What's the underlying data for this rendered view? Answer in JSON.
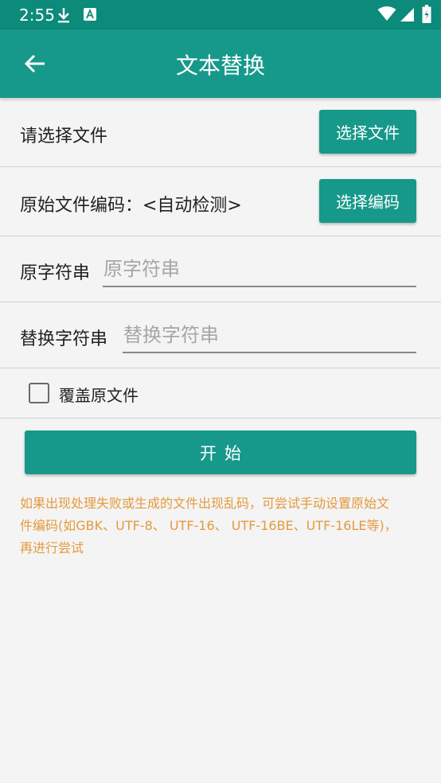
{
  "status_bar": {
    "time": "2:55",
    "icons": [
      "download-icon",
      "a-icon",
      "wifi-icon",
      "signal-icon",
      "battery-icon"
    ]
  },
  "app_bar": {
    "title": "文本替换",
    "back_icon": "arrow-back-icon"
  },
  "file_row": {
    "label": "请选择文件",
    "button_label": "选择文件"
  },
  "encoding_row": {
    "label": "原始文件编码：<自动检测>",
    "button_label": "选择编码"
  },
  "original_string_row": {
    "label": "原字符串",
    "value": "",
    "placeholder": "原字符串"
  },
  "replace_string_row": {
    "label": "替换字符串",
    "value": "",
    "placeholder": "替换字符串"
  },
  "overwrite_option": {
    "label": "覆盖原文件",
    "checked": false
  },
  "start_button": {
    "label": "开始"
  },
  "hint": "如果出现处理失败或生成的文件出现乱码，可尝试手动设置原始文件编码(如GBK、UTF-8、 UTF-16、 UTF-16BE、UTF-16LE等)，再进行尝试",
  "colors": {
    "status_bar": "#0c8a7a",
    "primary": "#16998a",
    "background": "#f4f4f4",
    "hint": "#e59a3b"
  }
}
